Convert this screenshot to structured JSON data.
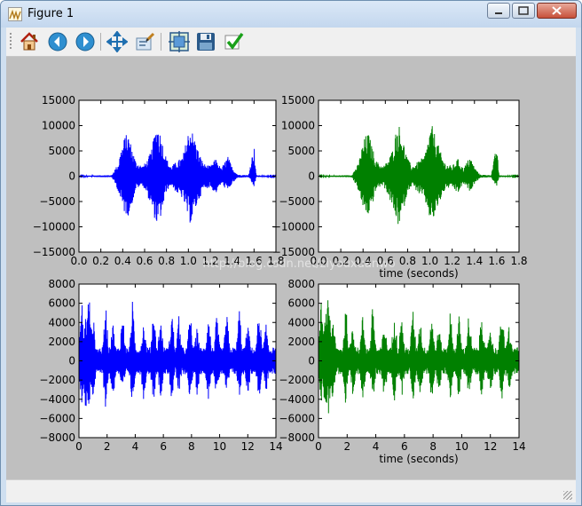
{
  "window": {
    "title": "Figure 1",
    "icon": "matplotlib-figure-icon"
  },
  "toolbar": {
    "buttons": [
      {
        "name": "home",
        "icon": "home-icon"
      },
      {
        "name": "back",
        "icon": "arrow-left-icon"
      },
      {
        "name": "forward",
        "icon": "arrow-right-icon"
      },
      {
        "name": "pan",
        "icon": "pan-move-icon"
      },
      {
        "name": "zoom",
        "icon": "zoom-rect-icon"
      },
      {
        "name": "subplots",
        "icon": "configure-subplots-icon"
      },
      {
        "name": "save",
        "icon": "save-disk-icon"
      },
      {
        "name": "edit",
        "icon": "checkmark-icon"
      }
    ]
  },
  "watermark": "http://blog.csdn.net/ziyouxuanwo",
  "colors": {
    "blue": "#0000ff",
    "green": "#008000",
    "canvas": "#bfbfbf"
  },
  "chart_data": [
    {
      "type": "line",
      "position": "top-left",
      "xlim": [
        0.0,
        1.8
      ],
      "ylim": [
        -15000,
        15000
      ],
      "xticks": [
        "0.0",
        "0.2",
        "0.4",
        "0.6",
        "0.8",
        "1.0",
        "1.2",
        "1.4",
        "1.6",
        "1.8"
      ],
      "yticks": [
        "15000",
        "10000",
        "5000",
        "0",
        "−5000",
        "−10000",
        "−15000"
      ],
      "xlabel": "",
      "series_color": "#0000ff",
      "envelope": {
        "x": [
          0,
          0.3,
          0.33,
          0.36,
          0.38,
          0.42,
          0.45,
          0.48,
          0.52,
          0.58,
          0.62,
          0.66,
          0.7,
          0.72,
          0.75,
          0.8,
          0.84,
          0.9,
          0.95,
          1.0,
          1.02,
          1.05,
          1.1,
          1.14,
          1.2,
          1.25,
          1.3,
          1.36,
          1.4,
          1.45,
          1.55,
          1.6,
          1.62,
          1.66,
          1.8
        ],
        "upper": [
          100,
          200,
          1500,
          2500,
          5000,
          8000,
          8500,
          6000,
          3000,
          2000,
          3000,
          5000,
          9500,
          10500,
          8000,
          3500,
          2000,
          3000,
          4000,
          9000,
          10000,
          8000,
          4500,
          2500,
          2000,
          3500,
          1500,
          4000,
          1800,
          300,
          200,
          6200,
          200,
          150,
          100
        ],
        "lower": [
          -100,
          -200,
          -1500,
          -3000,
          -5000,
          -7500,
          -7800,
          -6000,
          -2500,
          -1800,
          -3500,
          -6000,
          -9000,
          -10000,
          -8000,
          -3000,
          -1800,
          -3500,
          -4500,
          -8500,
          -9500,
          -7500,
          -4500,
          -2500,
          -2200,
          -3500,
          -1500,
          -3000,
          -1500,
          -300,
          -200,
          -2200,
          -200,
          -150,
          -100
        ]
      }
    },
    {
      "type": "line",
      "position": "top-right",
      "xlim": [
        0.0,
        1.8
      ],
      "ylim": [
        -15000,
        15000
      ],
      "xticks": [
        "0.0",
        "0.2",
        "0.4",
        "0.6",
        "0.8",
        "1.0",
        "1.2",
        "1.4",
        "1.6",
        "1.8"
      ],
      "yticks": [
        "15000",
        "10000",
        "5000",
        "0",
        "−5000",
        "−10000",
        "−15000"
      ],
      "xlabel": "time (seconds)",
      "series_color": "#008000",
      "envelope": {
        "x": [
          0,
          0.3,
          0.33,
          0.36,
          0.38,
          0.42,
          0.45,
          0.48,
          0.52,
          0.58,
          0.62,
          0.66,
          0.7,
          0.72,
          0.75,
          0.8,
          0.84,
          0.9,
          0.95,
          1.0,
          1.02,
          1.05,
          1.1,
          1.14,
          1.2,
          1.25,
          1.3,
          1.36,
          1.4,
          1.45,
          1.55,
          1.6,
          1.62,
          1.66,
          1.8
        ],
        "upper": [
          100,
          200,
          1500,
          2500,
          5000,
          8000,
          8500,
          6000,
          3000,
          2000,
          3000,
          5000,
          9500,
          10500,
          8000,
          3500,
          2000,
          3000,
          4000,
          9000,
          10000,
          8000,
          4500,
          2500,
          2000,
          3500,
          1500,
          4000,
          1800,
          300,
          200,
          6200,
          200,
          150,
          100
        ],
        "lower": [
          -100,
          -200,
          -1500,
          -3000,
          -5000,
          -7500,
          -7800,
          -6000,
          -2500,
          -1800,
          -3500,
          -6000,
          -9000,
          -10000,
          -8000,
          -3000,
          -1800,
          -3500,
          -4500,
          -8500,
          -9500,
          -7500,
          -4500,
          -2500,
          -2200,
          -3500,
          -1500,
          -3000,
          -1500,
          -300,
          -200,
          -2200,
          -200,
          -150,
          -100
        ]
      }
    },
    {
      "type": "line",
      "position": "bottom-left",
      "xlim": [
        0,
        14
      ],
      "ylim": [
        -8000,
        8000
      ],
      "xticks": [
        "0",
        "2",
        "4",
        "6",
        "8",
        "10",
        "12",
        "14"
      ],
      "yticks": [
        "8000",
        "6000",
        "4000",
        "2000",
        "0",
        "−2000",
        "−4000",
        "−6000",
        "−8000"
      ],
      "xlabel": "",
      "series_color": "#0000ff",
      "peaks": [
        [
          0.2,
          6500,
          -4500
        ],
        [
          0.5,
          5500,
          -6500
        ],
        [
          0.7,
          7800,
          -5800
        ],
        [
          1.0,
          5000,
          -4000
        ],
        [
          1.9,
          6200,
          -5200
        ],
        [
          2.4,
          4300,
          -4300
        ],
        [
          3.1,
          5200,
          -4000
        ],
        [
          3.8,
          6300,
          -4800
        ],
        [
          4.6,
          4200,
          -4200
        ],
        [
          5.3,
          5800,
          -4400
        ],
        [
          5.8,
          4700,
          -4000
        ],
        [
          6.6,
          5600,
          -4400
        ],
        [
          7.1,
          4700,
          -3800
        ],
        [
          7.9,
          5400,
          -4200
        ],
        [
          8.4,
          3600,
          -3600
        ],
        [
          9.2,
          5400,
          -4000
        ],
        [
          9.8,
          4900,
          -4200
        ],
        [
          10.5,
          5300,
          -3800
        ],
        [
          11.4,
          5800,
          -4000
        ],
        [
          12.0,
          4000,
          -3600
        ],
        [
          12.8,
          5800,
          -4300
        ],
        [
          13.3,
          3800,
          -3400
        ]
      ]
    },
    {
      "type": "line",
      "position": "bottom-right",
      "xlim": [
        0,
        14
      ],
      "ylim": [
        -8000,
        8000
      ],
      "xticks": [
        "0",
        "2",
        "4",
        "6",
        "8",
        "10",
        "12",
        "14"
      ],
      "yticks": [
        "8000",
        "6000",
        "4000",
        "2000",
        "0",
        "−2000",
        "−4000",
        "−6000",
        "−8000"
      ],
      "xlabel": "time (seconds)",
      "series_color": "#008000",
      "peaks": [
        [
          0.2,
          6500,
          -4500
        ],
        [
          0.5,
          5500,
          -6500
        ],
        [
          0.7,
          7800,
          -5800
        ],
        [
          1.0,
          5000,
          -4000
        ],
        [
          1.9,
          6200,
          -5200
        ],
        [
          2.4,
          4300,
          -4300
        ],
        [
          3.1,
          5200,
          -4000
        ],
        [
          3.8,
          6300,
          -4800
        ],
        [
          4.6,
          4200,
          -4200
        ],
        [
          5.3,
          5800,
          -4400
        ],
        [
          5.8,
          4700,
          -4000
        ],
        [
          6.6,
          5600,
          -4400
        ],
        [
          7.1,
          4700,
          -3800
        ],
        [
          7.9,
          5400,
          -4200
        ],
        [
          8.4,
          3600,
          -3600
        ],
        [
          9.2,
          5400,
          -4000
        ],
        [
          9.8,
          4900,
          -4200
        ],
        [
          10.5,
          5300,
          -3800
        ],
        [
          11.4,
          5800,
          -4000
        ],
        [
          12.0,
          4000,
          -3600
        ],
        [
          12.8,
          5800,
          -4300
        ],
        [
          13.3,
          3800,
          -3400
        ]
      ]
    }
  ]
}
